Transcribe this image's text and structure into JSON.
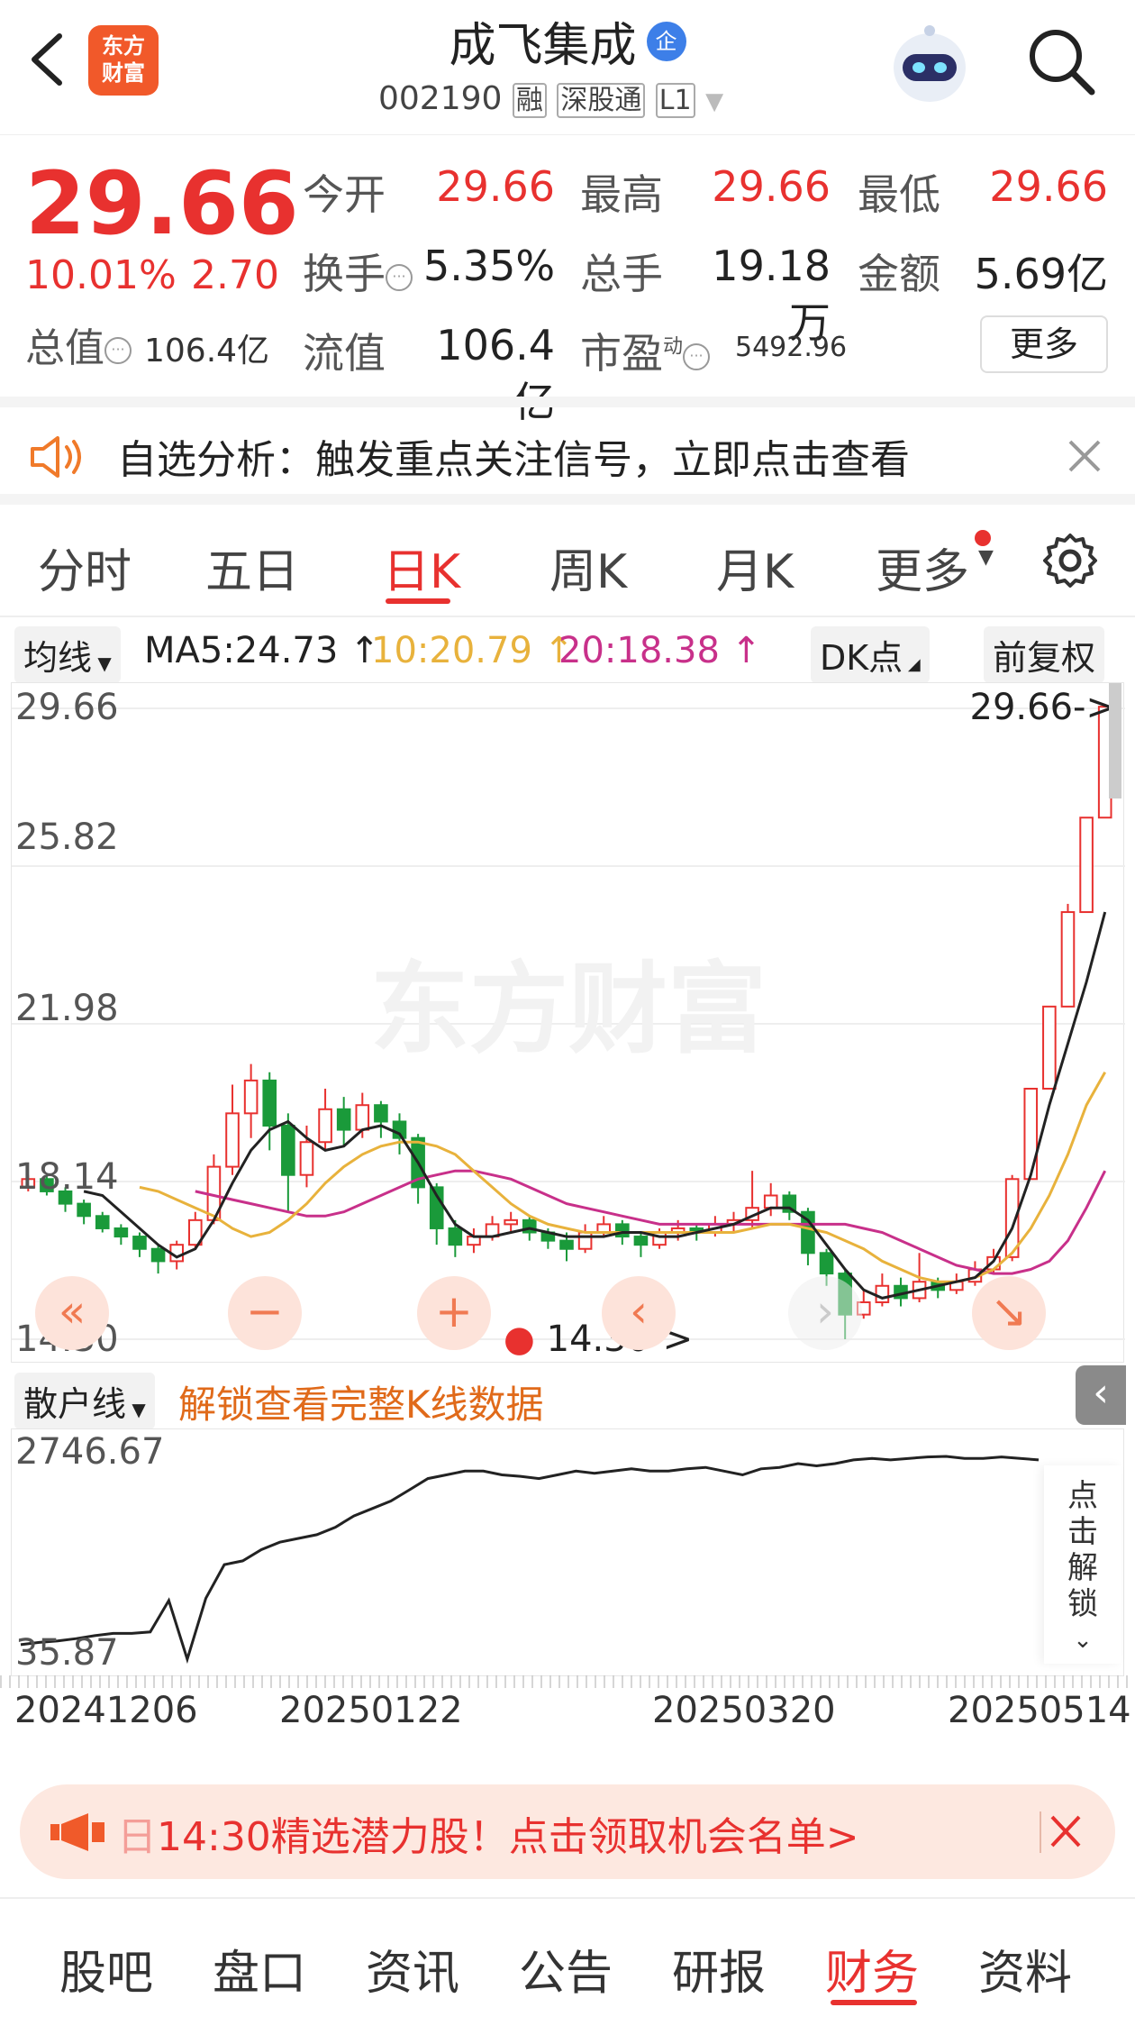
{
  "header": {
    "title": "成飞集成",
    "badge": "企",
    "code": "002190",
    "tags": [
      "融",
      "深股通",
      "L1"
    ],
    "logo_text": "东方\n财富"
  },
  "quote": {
    "price": "29.66",
    "change_pct": "10.01%",
    "change_amt": "2.70",
    "total_value_label": "总值",
    "total_value": "106.4亿",
    "rows": [
      [
        {
          "label": "今开",
          "value": "29.66"
        },
        {
          "label": "最高",
          "value": "29.66"
        },
        {
          "label": "最低",
          "value": "29.66"
        }
      ],
      [
        {
          "label": "换手",
          "value": "5.35%"
        },
        {
          "label": "总手",
          "value": "19.18万"
        },
        {
          "label": "金额",
          "value": "5.69亿"
        }
      ]
    ],
    "float_label": "流值",
    "float_value": "106.4亿",
    "pe_label": "市盈",
    "pe_sup": "动",
    "pe_value": "5492.96",
    "more_button": "更多"
  },
  "alert": {
    "text": "自选分析：触发重点关注信号，立即点击查看"
  },
  "tabs": {
    "items": [
      "分时",
      "五日",
      "日K",
      "周K",
      "月K",
      "更多"
    ],
    "active": 2
  },
  "ma_bar": {
    "selector": "均线",
    "ma5": "MA5:24.73",
    "ma10": "10:20.79",
    "ma20": "20:18.38",
    "dk": "DK点",
    "adjust": "前复权"
  },
  "colors": {
    "ma5": "#222222",
    "ma10": "#e8b23c",
    "ma20": "#c8308a",
    "up": "#e8312f",
    "down": "#1a9a3a",
    "accent": "#e8312f"
  },
  "kline": {
    "y_labels": [
      "29.66",
      "25.82",
      "21.98",
      "18.14",
      "14.30"
    ],
    "max_label": "29.66->",
    "min_label": "14.30->",
    "watermark": "东方财富",
    "nav": [
      "«",
      "−",
      "+",
      "‹",
      "›"
    ],
    "candles": [
      [
        18.0,
        18.2,
        17.9,
        18.3
      ],
      [
        18.2,
        17.9,
        17.8,
        18.3
      ],
      [
        17.9,
        17.6,
        17.4,
        18.0
      ],
      [
        17.6,
        17.3,
        17.1,
        17.7
      ],
      [
        17.3,
        17.0,
        16.9,
        17.4
      ],
      [
        17.0,
        16.8,
        16.6,
        17.1
      ],
      [
        16.8,
        16.5,
        16.3,
        16.9
      ],
      [
        16.5,
        16.2,
        15.9,
        16.6
      ],
      [
        16.2,
        16.6,
        16.0,
        16.7
      ],
      [
        16.6,
        17.2,
        16.5,
        17.4
      ],
      [
        17.2,
        18.5,
        17.1,
        18.8
      ],
      [
        18.5,
        19.8,
        18.3,
        20.5
      ],
      [
        19.8,
        20.6,
        19.2,
        21.0
      ],
      [
        20.6,
        19.5,
        18.9,
        20.8
      ],
      [
        19.5,
        18.3,
        17.4,
        19.8
      ],
      [
        18.3,
        19.1,
        18.0,
        19.5
      ],
      [
        19.1,
        19.9,
        18.9,
        20.4
      ],
      [
        19.9,
        19.4,
        19.0,
        20.2
      ],
      [
        19.4,
        20.0,
        19.2,
        20.3
      ],
      [
        20.0,
        19.6,
        19.2,
        20.1
      ],
      [
        19.6,
        19.2,
        18.8,
        19.8
      ],
      [
        19.2,
        18.0,
        17.6,
        19.3
      ],
      [
        18.0,
        17.0,
        16.6,
        18.1
      ],
      [
        17.0,
        16.6,
        16.3,
        17.2
      ],
      [
        16.6,
        16.8,
        16.4,
        17.0
      ],
      [
        16.8,
        17.1,
        16.7,
        17.3
      ],
      [
        17.1,
        17.2,
        16.9,
        17.4
      ],
      [
        17.2,
        16.9,
        16.7,
        17.3
      ],
      [
        16.9,
        16.7,
        16.5,
        17.0
      ],
      [
        16.7,
        16.5,
        16.2,
        16.9
      ],
      [
        16.5,
        16.9,
        16.4,
        17.1
      ],
      [
        16.9,
        17.1,
        16.8,
        17.3
      ],
      [
        17.1,
        16.8,
        16.6,
        17.2
      ],
      [
        16.8,
        16.6,
        16.3,
        16.9
      ],
      [
        16.6,
        16.9,
        16.5,
        17.0
      ],
      [
        16.9,
        17.0,
        16.7,
        17.2
      ],
      [
        17.0,
        16.9,
        16.7,
        17.1
      ],
      [
        16.9,
        17.1,
        16.8,
        17.3
      ],
      [
        17.1,
        17.2,
        16.9,
        17.4
      ],
      [
        17.2,
        17.5,
        17.0,
        18.4
      ],
      [
        17.5,
        17.8,
        17.3,
        18.1
      ],
      [
        17.8,
        17.4,
        17.2,
        17.9
      ],
      [
        17.4,
        16.4,
        16.1,
        17.5
      ],
      [
        16.4,
        15.9,
        15.6,
        16.5
      ],
      [
        15.9,
        14.9,
        14.3,
        16.0
      ],
      [
        14.9,
        15.2,
        14.8,
        15.5
      ],
      [
        15.2,
        15.6,
        15.1,
        15.9
      ],
      [
        15.6,
        15.3,
        15.1,
        15.8
      ],
      [
        15.3,
        15.7,
        15.2,
        16.4
      ],
      [
        15.7,
        15.5,
        15.3,
        15.8
      ],
      [
        15.5,
        15.7,
        15.4,
        15.9
      ],
      [
        15.7,
        16.0,
        15.6,
        16.2
      ],
      [
        16.0,
        16.3,
        15.9,
        16.5
      ],
      [
        16.3,
        18.2,
        16.2,
        18.3
      ],
      [
        18.2,
        20.4,
        18.2,
        20.4
      ],
      [
        20.4,
        22.4,
        22.4,
        22.4
      ],
      [
        22.4,
        24.7,
        24.7,
        24.9
      ],
      [
        24.7,
        27.0,
        27.0,
        27.0
      ],
      [
        27.0,
        29.7,
        29.7,
        29.7
      ]
    ],
    "ma5": [
      17.9,
      17.8,
      17.4,
      17.0,
      16.6,
      16.3,
      16.5,
      17.2,
      18.1,
      18.9,
      19.4,
      19.6,
      19.2,
      18.9,
      19.0,
      19.4,
      19.5,
      19.3,
      18.6,
      17.8,
      17.1,
      16.8,
      16.8,
      16.9,
      17.0,
      16.9,
      16.8,
      16.8,
      16.8,
      16.9,
      16.9,
      16.8,
      16.8,
      16.9,
      17.0,
      17.1,
      17.3,
      17.5,
      17.5,
      17.2,
      16.6,
      16.0,
      15.5,
      15.3,
      15.4,
      15.5,
      15.6,
      15.7,
      15.8,
      16.2,
      17.0,
      18.3,
      20.0,
      21.5,
      23.0,
      24.7
    ],
    "ma10": [
      18.0,
      17.9,
      17.7,
      17.5,
      17.3,
      17.0,
      16.8,
      16.9,
      17.2,
      17.6,
      18.1,
      18.5,
      18.8,
      19.0,
      19.1,
      19.1,
      19.0,
      18.8,
      18.4,
      18.0,
      17.6,
      17.3,
      17.1,
      17.0,
      16.9,
      16.9,
      16.9,
      16.9,
      16.9,
      16.9,
      16.9,
      16.9,
      16.9,
      17.0,
      17.1,
      17.1,
      17.0,
      16.9,
      16.7,
      16.5,
      16.2,
      16.0,
      15.8,
      15.7,
      15.7,
      15.8,
      16.0,
      16.4,
      17.0,
      17.8,
      18.8,
      20.0,
      20.8
    ],
    "ma20": [
      17.9,
      17.8,
      17.7,
      17.6,
      17.5,
      17.4,
      17.3,
      17.3,
      17.4,
      17.6,
      17.8,
      18.0,
      18.2,
      18.3,
      18.4,
      18.4,
      18.3,
      18.2,
      18.0,
      17.8,
      17.6,
      17.5,
      17.4,
      17.3,
      17.2,
      17.1,
      17.1,
      17.1,
      17.1,
      17.1,
      17.1,
      17.1,
      17.1,
      17.1,
      17.1,
      17.1,
      17.0,
      16.9,
      16.7,
      16.5,
      16.3,
      16.1,
      16.0,
      15.9,
      15.9,
      16.0,
      16.2,
      16.7,
      17.5,
      18.4
    ]
  },
  "sub_indicator": {
    "selector": "散户线",
    "unlock_text": "解锁查看完整K线数据",
    "y_labels": [
      "2746.67",
      "35.87"
    ],
    "side_unlock": "点击解锁",
    "line": [
      230,
      260,
      280,
      310,
      350,
      380,
      380,
      400,
      820,
      30,
      850,
      1300,
      1350,
      1500,
      1600,
      1650,
      1700,
      1800,
      1950,
      2050,
      2150,
      2300,
      2450,
      2500,
      2550,
      2550,
      2500,
      2480,
      2450,
      2500,
      2550,
      2520,
      2550,
      2580,
      2550,
      2550,
      2580,
      2600,
      2550,
      2500,
      2580,
      2600,
      2650,
      2620,
      2650,
      2700,
      2720,
      2700,
      2720,
      2740,
      2746.67,
      2720,
      2720,
      2740,
      2720,
      2700
    ]
  },
  "dates": [
    "20241206",
    "20250122",
    "20250320",
    "20250514"
  ],
  "promo": {
    "prefix": "日",
    "text": "14:30精选潜力股！点击领取机会名单>"
  },
  "bottom_tabs": {
    "items": [
      "股吧",
      "盘口",
      "资讯",
      "公告",
      "研报",
      "财务",
      "资料"
    ],
    "active": 5
  }
}
